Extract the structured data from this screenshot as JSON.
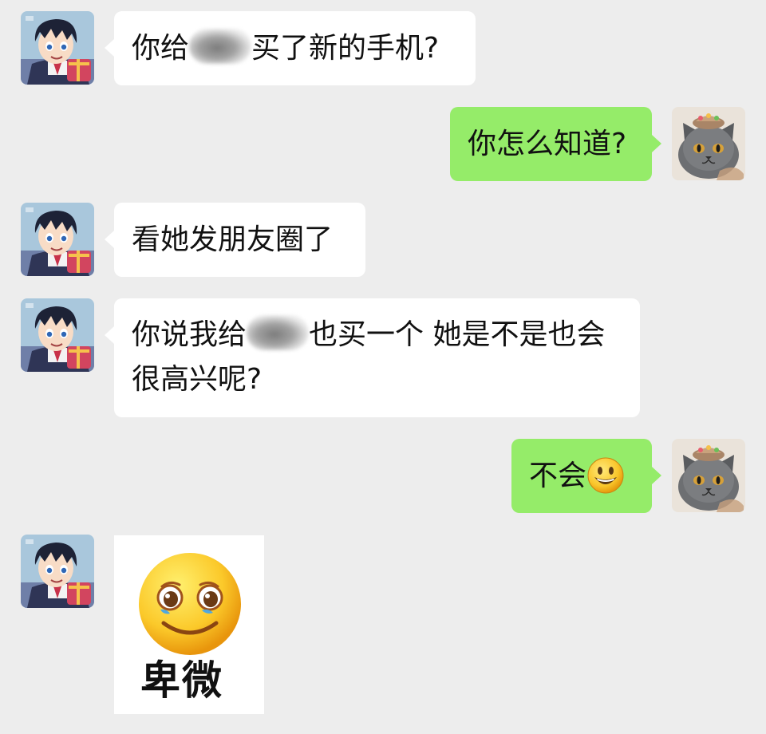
{
  "chat": {
    "messages": [
      {
        "sender": "friend",
        "avatar_icon": "anime-boy-avatar",
        "parts": [
          "你给",
          "[blurred name]",
          "买了新的手机?"
        ]
      },
      {
        "sender": "me",
        "avatar_icon": "gray-cat-avatar",
        "text": "你怎么知道?"
      },
      {
        "sender": "friend",
        "avatar_icon": "anime-boy-avatar",
        "text": "看她发朋友圈了"
      },
      {
        "sender": "friend",
        "avatar_icon": "anime-boy-avatar",
        "lines": [
          [
            "你说我给",
            "[blurred name]",
            "也买一个 她是不是也会"
          ],
          "很高兴呢?"
        ]
      },
      {
        "sender": "me",
        "avatar_icon": "gray-cat-avatar",
        "text": "不会",
        "emoji_icon": "smiling-face-emoji-icon"
      },
      {
        "sender": "friend",
        "avatar_icon": "anime-boy-avatar",
        "sticker": {
          "icon": "crying-smile-emoji-icon",
          "caption": "卑微"
        }
      }
    ]
  },
  "colors": {
    "background": "#ededed",
    "incoming_bubble": "#ffffff",
    "outgoing_bubble": "#95ec69"
  }
}
